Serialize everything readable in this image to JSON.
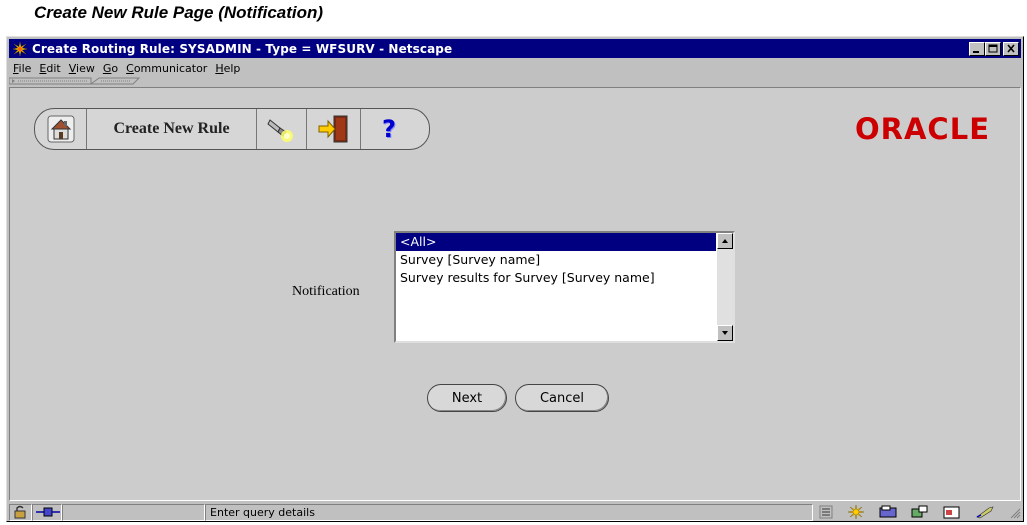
{
  "caption": "Create New Rule Page (Notification)",
  "window": {
    "title": "Create Routing Rule: SYSADMIN - Type = WFSURV - Netscape"
  },
  "menu": [
    {
      "label": "File",
      "underline": "F",
      "rest": "ile"
    },
    {
      "label": "Edit",
      "underline": "E",
      "rest": "dit"
    },
    {
      "label": "View",
      "underline": "V",
      "rest": "iew"
    },
    {
      "label": "Go",
      "underline": "G",
      "rest": "o"
    },
    {
      "label": "Communicator",
      "underline": "C",
      "rest": "ommunicator"
    },
    {
      "label": "Help",
      "underline": "H",
      "rest": "elp"
    }
  ],
  "toolbar": {
    "title": "Create New Rule",
    "help_symbol": "?"
  },
  "brand": {
    "logo_text": "ORACLE",
    "color": "#cc0000"
  },
  "form": {
    "notification_label": "Notification",
    "options": [
      "<All>",
      "Survey [Survey name]",
      "Survey results for Survey [Survey name]"
    ],
    "selected_index": 0,
    "next_label": "Next",
    "cancel_label": "Cancel"
  },
  "status": {
    "message": "Enter query details"
  },
  "colors": {
    "titlebar": "#000080",
    "selection": "#000080",
    "window_bg": "#c0c0c0"
  }
}
